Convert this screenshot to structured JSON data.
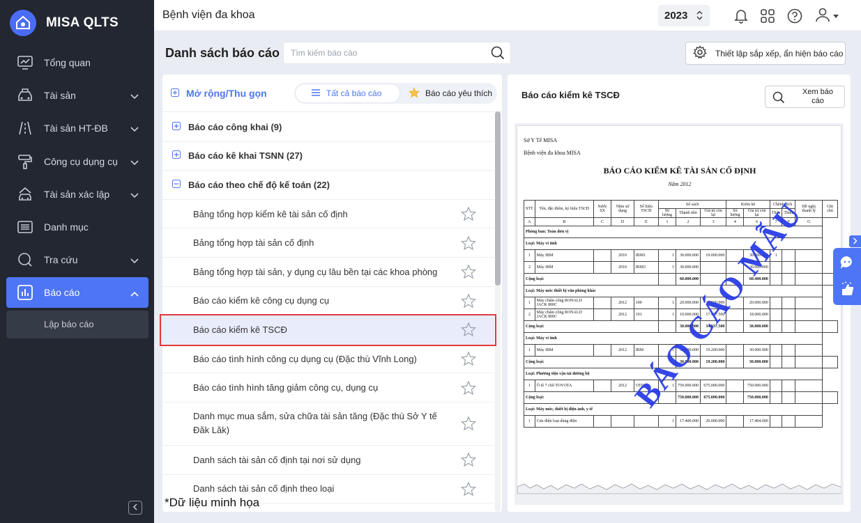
{
  "app": {
    "name": "MISA QLTS"
  },
  "sidebar": {
    "items": [
      {
        "label": "Tổng quan",
        "icon": "monitor-chart-icon",
        "has_chevron": false
      },
      {
        "label": "Tài sản",
        "icon": "car-building-icon",
        "has_chevron": true
      },
      {
        "label": "Tài sản HT-ĐB",
        "icon": "road-icon",
        "has_chevron": true
      },
      {
        "label": "Công cụ dụng cụ",
        "icon": "paint-roller-icon",
        "has_chevron": true
      },
      {
        "label": "Tài sản xác lập",
        "icon": "car-house-icon",
        "has_chevron": true
      },
      {
        "label": "Danh mục",
        "icon": "list-icon",
        "has_chevron": false
      },
      {
        "label": "Tra cứu",
        "icon": "search-icon",
        "has_chevron": true
      },
      {
        "label": "Báo cáo",
        "icon": "bar-chart-icon",
        "has_chevron": true,
        "active": true
      }
    ],
    "sub_item": "Lập báo cáo"
  },
  "topbar": {
    "org_name": "Bệnh viện đa khoa",
    "year": "2023"
  },
  "page": {
    "title": "Danh sách báo cáo",
    "search_placeholder": "Tìm kiếm báo cáo",
    "settings_label": "Thiết lập sắp xếp, ẩn hiện báo cáo"
  },
  "report_list": {
    "expand_label": "Mở rộng/Thu gọn",
    "tab_all": "Tất cả báo cáo",
    "tab_fav": "Báo cáo yêu thích",
    "groups": [
      {
        "label": "Báo cáo công khai (9)",
        "expanded": false
      },
      {
        "label": "Báo cáo kê khai TSNN (27)",
        "expanded": false
      },
      {
        "label": "Báo cáo theo chế độ kế toán (22)",
        "expanded": true
      }
    ],
    "items": [
      "Bảng tổng hợp kiểm kê tài sản cố định",
      "Bảng tổng hợp tài sản cố định",
      "Bảng tổng hợp tài sản, y dụng cụ lâu bền tại các khoa phòng",
      "Báo cáo kiểm kê công cụ dụng cụ",
      "Báo cáo kiểm kê TSCĐ",
      "Báo cáo tình hình công cụ dụng cụ (Đặc thù Vĩnh Long)",
      "Báo cáo tình hình tăng giảm công cụ, dụng cụ",
      "Danh mục mua sắm, sửa chữa tài sản tăng (Đặc thù Sở Y tế Đăk Lăk)",
      "Danh sách tài sản cố định tại nơi sử dụng",
      "Danh sách tài sản cố định theo loại"
    ],
    "selected_index": 4,
    "note": "*Dữ liệu minh họa"
  },
  "preview": {
    "title": "Báo cáo kiểm kê TSCĐ",
    "view_button": "Xem báo cáo",
    "doc": {
      "org1": "Sở Y Tế MISA",
      "org2": "Bệnh viện đa khoa MISA",
      "title": "BÁO CÁO KIỂM KÊ TÀI SẢN CỐ ĐỊNH",
      "year": "Năm 2012",
      "watermark": "BÁO CÁO MẪU",
      "header1": [
        "STT",
        "Tên, đặc điểm, ký hiệu TSCĐ",
        "Nước SX",
        "Năm sử dụng",
        "Số hiệu TSCĐ",
        "Sổ sách",
        "Kiểm kê",
        "Chênh lệch",
        "Đề nghị thanh lý",
        "Ghi chú"
      ],
      "header2": [
        "Số lượng",
        "Thành tiền",
        "Giá trị còn lại",
        "Số lượng",
        "Giá trị còn lại",
        "Thừa",
        "Thiếu"
      ],
      "header3": [
        "A",
        "B",
        "C",
        "D",
        "E",
        "1",
        "2",
        "3",
        "4",
        "6",
        "7",
        "F",
        "G"
      ],
      "rows": [
        {
          "type": "sec",
          "text": "Phòng ban: Toàn đơn vị"
        },
        {
          "type": "sec",
          "text": "Loại: Máy vi tính"
        },
        {
          "type": "row",
          "cells": [
            "1",
            "Máy IBM",
            "",
            "2010",
            "IBM1",
            "1",
            "30.000.000",
            "19.000.000",
            "",
            "30.400.000",
            "1",
            "",
            "",
            ""
          ]
        },
        {
          "type": "row",
          "cells": [
            "2",
            "Máy IBM",
            "",
            "2010",
            "IBM3",
            "1",
            "30.000.000",
            "",
            "",
            "30.000.000",
            "",
            "",
            "",
            ""
          ]
        },
        {
          "type": "total",
          "cells": [
            "Cộng loại:",
            "",
            "60.000.000",
            "",
            "",
            "68.400.000"
          ]
        },
        {
          "type": "sec",
          "text": "Loại: Máy móc thiết bị văn phòng khác"
        },
        {
          "type": "row",
          "cells": [
            "1",
            "Máy chấm công RONALD JACK 800C",
            "",
            "2012",
            "100",
            "1",
            "20.000.000",
            "17.500.000",
            "",
            "20.000.000",
            "",
            "",
            "",
            ""
          ]
        },
        {
          "type": "row",
          "cells": [
            "2",
            "Máy chấm công RONALD JACK 800C",
            "",
            "2012",
            "101",
            "1",
            "10.000.000",
            "17.437.500",
            "",
            "18.000.000",
            "",
            "",
            "",
            ""
          ]
        },
        {
          "type": "total",
          "cells": [
            "Cộng loại:",
            "",
            "30.000.000",
            "34.937.500",
            "",
            "38.000.000"
          ]
        },
        {
          "type": "sec",
          "text": "Loại: Máy vi tính"
        },
        {
          "type": "row",
          "cells": [
            "1",
            "Máy IBM",
            "",
            "2012",
            "IBM",
            "1",
            "30.000.000",
            "19.200.000",
            "",
            "30.000.000",
            "",
            "",
            "",
            ""
          ]
        },
        {
          "type": "total",
          "cells": [
            "Cộng loại:",
            "",
            "30.000.000",
            "19.200.000",
            "",
            "30.000.000"
          ]
        },
        {
          "type": "sec",
          "text": "Loại: Phương tiện vận tải đường bộ"
        },
        {
          "type": "row",
          "cells": [
            "1",
            "Ô tô 7 chỗ TOYOTA",
            "",
            "2012",
            "OTO",
            "1",
            "750.000.000",
            "675.000.000",
            "",
            "750.000.000",
            "",
            "",
            "",
            ""
          ]
        },
        {
          "type": "total",
          "cells": [
            "Cộng loại:",
            "",
            "750.000.000",
            "675.000.000",
            "",
            "750.000.000"
          ]
        },
        {
          "type": "sec",
          "text": "Loại: Máy móc, thiết bị điện ảnh, y tế"
        },
        {
          "type": "row",
          "cells": [
            "1",
            "Cưa điện loại dùng điện",
            "",
            "",
            "",
            "1",
            "17.400.000",
            "20.000.000",
            "",
            "17.404.000",
            "",
            "",
            "",
            ""
          ]
        }
      ]
    }
  },
  "colors": {
    "primary": "#4e75f5",
    "sidebar_bg": "#222731",
    "selection_border": "#e0393e",
    "watermark": "#2438e6"
  }
}
